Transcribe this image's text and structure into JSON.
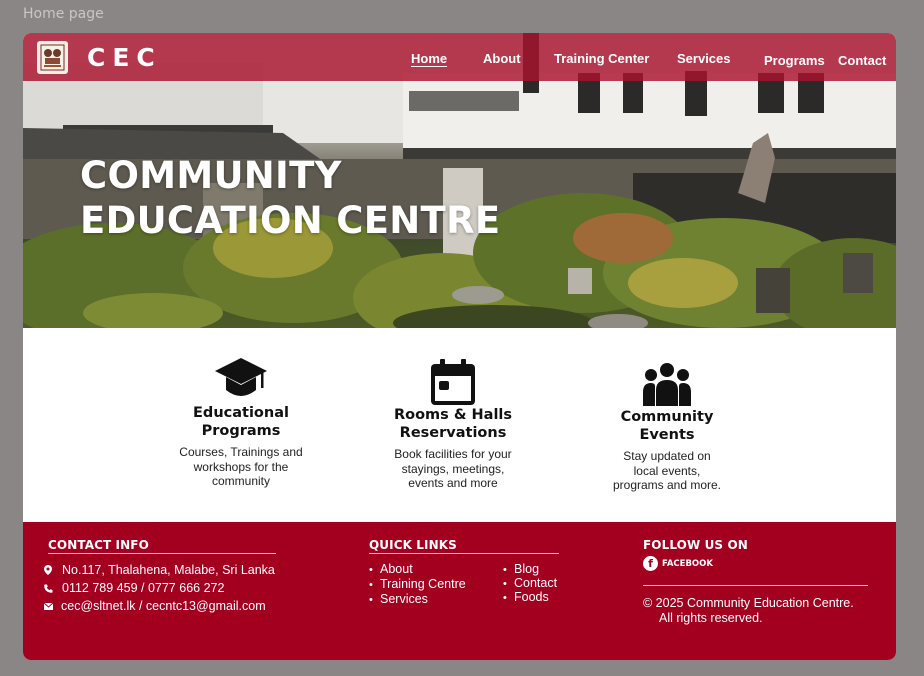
{
  "page_label": "Home page",
  "brand": {
    "name": "CEC"
  },
  "nav": {
    "items": [
      {
        "label": "Home",
        "active": true
      },
      {
        "label": "About"
      },
      {
        "label": "Training Center"
      },
      {
        "label": "Services"
      },
      {
        "label": "Programs"
      },
      {
        "label": "Contact"
      }
    ]
  },
  "hero": {
    "line1": "COMMUNITY",
    "line2": "EDUCATION CENTRE"
  },
  "features": [
    {
      "icon": "graduation-cap-icon",
      "title1": "Educational",
      "title2": "Programs",
      "desc": [
        "Courses, Trainings and",
        "workshops for the",
        "community"
      ]
    },
    {
      "icon": "calendar-icon",
      "title1": "Rooms & Halls",
      "title2": "Reservations",
      "desc": [
        "Book facilities for your",
        "stayings, meetings,",
        "events and more"
      ]
    },
    {
      "icon": "community-group-icon",
      "title1": "Community",
      "title2": "Events",
      "desc": [
        "Stay updated on",
        "local events,",
        "programs and more."
      ]
    }
  ],
  "footer": {
    "contact": {
      "heading": "CONTACT INFO",
      "address": "No.117, Thalahena, Malabe, Sri Lanka",
      "phone": "0112 789 459 / 0777 666 272",
      "email": "cec@sltnet.lk / cecntc13@gmail.com"
    },
    "quick_links": {
      "heading": "QUICK LINKS",
      "col1": [
        "About",
        "Training Centre",
        "Services"
      ],
      "col2": [
        "Blog",
        "Contact",
        "Foods"
      ]
    },
    "follow": {
      "heading": "FOLLOW US ON",
      "facebook": "FACEBOOK",
      "fb_glyph": "f"
    },
    "copyright_line1": "© 2025 Community Education Centre.",
    "copyright_line2": "All rights reserved."
  },
  "colors": {
    "nav_bg": "#aa122d",
    "footer_bg": "#a3001f",
    "text_light": "#ffffff"
  }
}
